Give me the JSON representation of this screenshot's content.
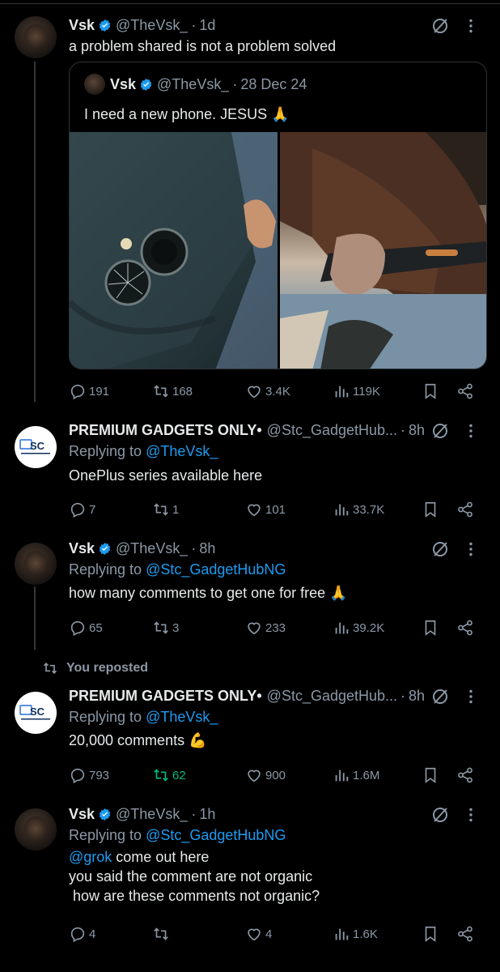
{
  "posts": [
    {
      "name": "Vsk",
      "handle": "@TheVsk_",
      "time": "1d",
      "text": "a problem shared is not a problem solved",
      "quote": {
        "name": "Vsk",
        "handle": "@TheVsk_",
        "time": "28 Dec 24",
        "text": "I need a new phone. JESUS 🙏"
      },
      "stats": {
        "replies": "191",
        "reposts": "168",
        "likes": "3.4K",
        "views": "119K"
      }
    },
    {
      "name": "PREMIUM GADGETS ONLY•",
      "handle": "@Stc_GadgetHub...",
      "time": "8h",
      "replying_prefix": "Replying to ",
      "replying_to": "@TheVsk_",
      "text": "OnePlus series available here",
      "stats": {
        "replies": "7",
        "reposts": "1",
        "likes": "101",
        "views": "33.7K"
      }
    },
    {
      "name": "Vsk",
      "handle": "@TheVsk_",
      "time": "8h",
      "replying_prefix": "Replying to ",
      "replying_to": "@Stc_GadgetHubNG",
      "text": "how many comments to get one for free 🙏",
      "stats": {
        "replies": "65",
        "reposts": "3",
        "likes": "233",
        "views": "39.2K"
      }
    },
    {
      "name": "PREMIUM GADGETS ONLY•",
      "handle": "@Stc_GadgetHub...",
      "time": "8h",
      "replying_prefix": "Replying to ",
      "replying_to": "@TheVsk_",
      "text": "20,000 comments 💪",
      "stats": {
        "replies": "793",
        "reposts": "62",
        "likes": "900",
        "views": "1.6M"
      }
    },
    {
      "name": "Vsk",
      "handle": "@TheVsk_",
      "time": "1h",
      "replying_prefix": "Replying to ",
      "replying_to": "@Stc_GadgetHubNG",
      "mention": "@grok",
      "text_after_mention": " come out here",
      "text_line2": "you said the comment are not organic",
      "text_line3": " how are these comments not organic?",
      "stats": {
        "replies": "4",
        "reposts": "",
        "likes": "4",
        "views": "1.6K"
      }
    }
  ],
  "repost_label": "You reposted",
  "brand_avatar_text": "SC",
  "colors": {
    "background": "#000000",
    "text": "#e7e9ea",
    "secondary": "#8b98a5",
    "link": "#1d9bf0",
    "repost_active": "#00ba7c",
    "verified": "#1d9bf0"
  },
  "icons": [
    "reply-icon",
    "repost-icon",
    "like-icon",
    "views-icon",
    "bookmark-icon",
    "share-icon",
    "grok-icon",
    "more-icon",
    "verified-badge-icon"
  ]
}
